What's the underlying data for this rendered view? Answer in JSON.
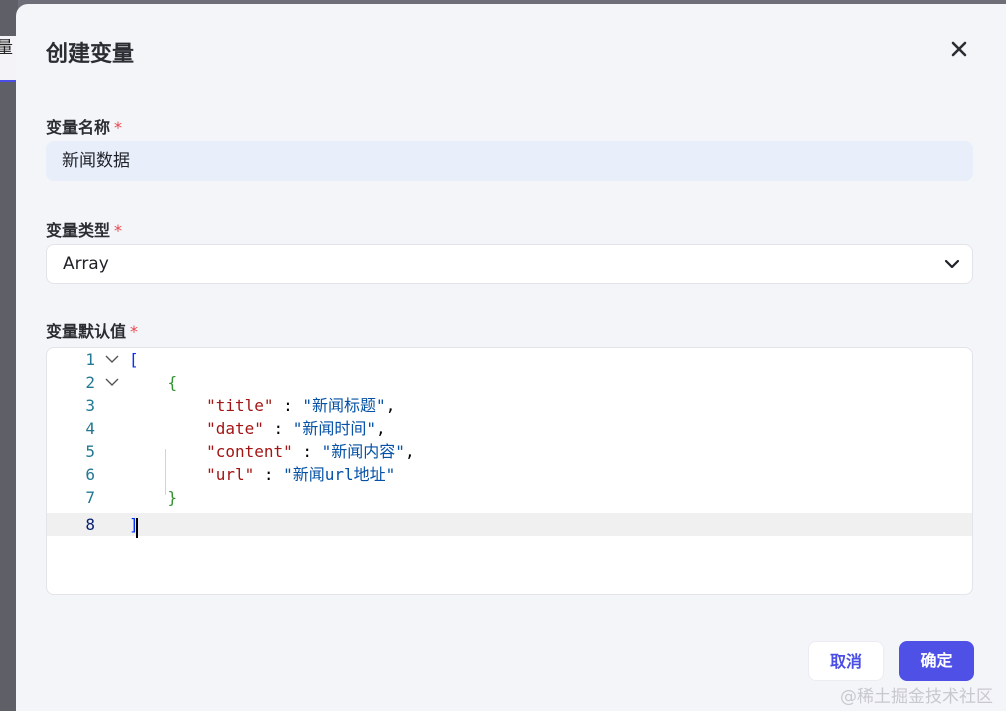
{
  "backdrop": {
    "tab_text": "量"
  },
  "dialog": {
    "title": "创建变量",
    "close_icon": "close-icon",
    "fields": {
      "name": {
        "label": "变量名称",
        "required_mark": "*",
        "value": "新闻数据"
      },
      "type": {
        "label": "变量类型",
        "required_mark": "*",
        "selected": "Array"
      },
      "default": {
        "label": "变量默认值",
        "required_mark": "*"
      }
    },
    "editor": {
      "lines": [
        {
          "number": "1",
          "foldable": true
        },
        {
          "number": "2",
          "foldable": true
        },
        {
          "number": "3",
          "foldable": false
        },
        {
          "number": "4",
          "foldable": false
        },
        {
          "number": "5",
          "foldable": false
        },
        {
          "number": "6",
          "foldable": false
        },
        {
          "number": "7",
          "foldable": false
        },
        {
          "number": "8",
          "foldable": false,
          "current": true
        }
      ],
      "tokens": {
        "open_bracket": "[",
        "open_brace": "{",
        "title_key": "\"title\"",
        "title_val": "\"新闻标题\"",
        "date_key": "\"date\"",
        "date_val": "\"新闻时间\"",
        "content_key": "\"content\"",
        "content_val": "\"新闻内容\"",
        "url_key": "\"url\"",
        "url_val": "\"新闻url地址\"",
        "close_brace": "}",
        "close_bracket": "]"
      }
    },
    "buttons": {
      "cancel": "取消",
      "confirm": "确定"
    }
  },
  "watermark": "@稀土掘金技术社区",
  "colors": {
    "accent": "#4f51e6",
    "required": "#e5484d",
    "input_bg": "#e8effb"
  }
}
